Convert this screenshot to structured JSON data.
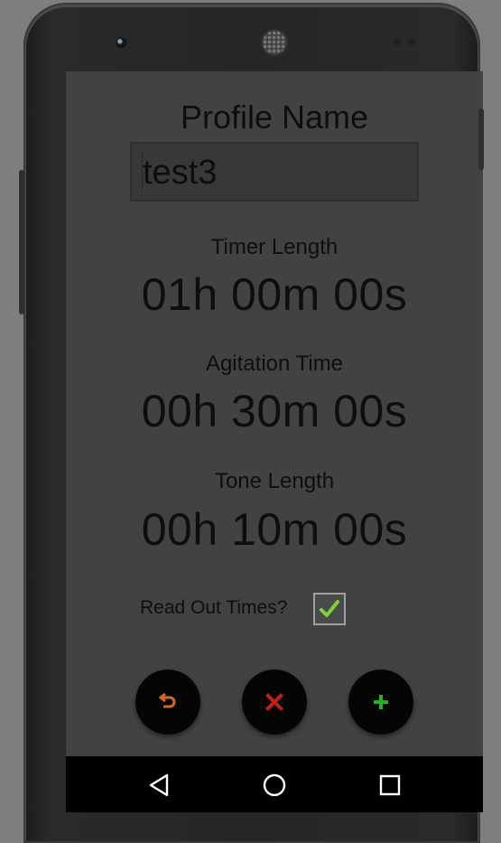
{
  "form": {
    "title": "Profile Name",
    "profile_name_value": "test3"
  },
  "timers": {
    "timer_length_label": "Timer Length",
    "timer_length_value": "01h 00m 00s",
    "agitation_time_label": "Agitation Time",
    "agitation_time_value": "00h 30m 00s",
    "tone_length_label": "Tone Length",
    "tone_length_value": "00h 10m 00s"
  },
  "options": {
    "read_out_times_label": "Read Out Times?",
    "read_out_times_checked": true
  },
  "actions": {
    "undo_icon": "undo-arrow-icon",
    "delete_icon": "close-x-icon",
    "add_icon": "plus-icon",
    "undo_color": "#d2691e",
    "delete_color": "#c0201a",
    "add_color": "#22b222"
  },
  "navigation": {
    "back_icon": "back-triangle-icon",
    "home_icon": "home-circle-icon",
    "recents_icon": "recents-square-icon"
  },
  "colors": {
    "screen_background": "#424242",
    "text": "#0e0e0e",
    "check_mark": "#7fd13b"
  }
}
